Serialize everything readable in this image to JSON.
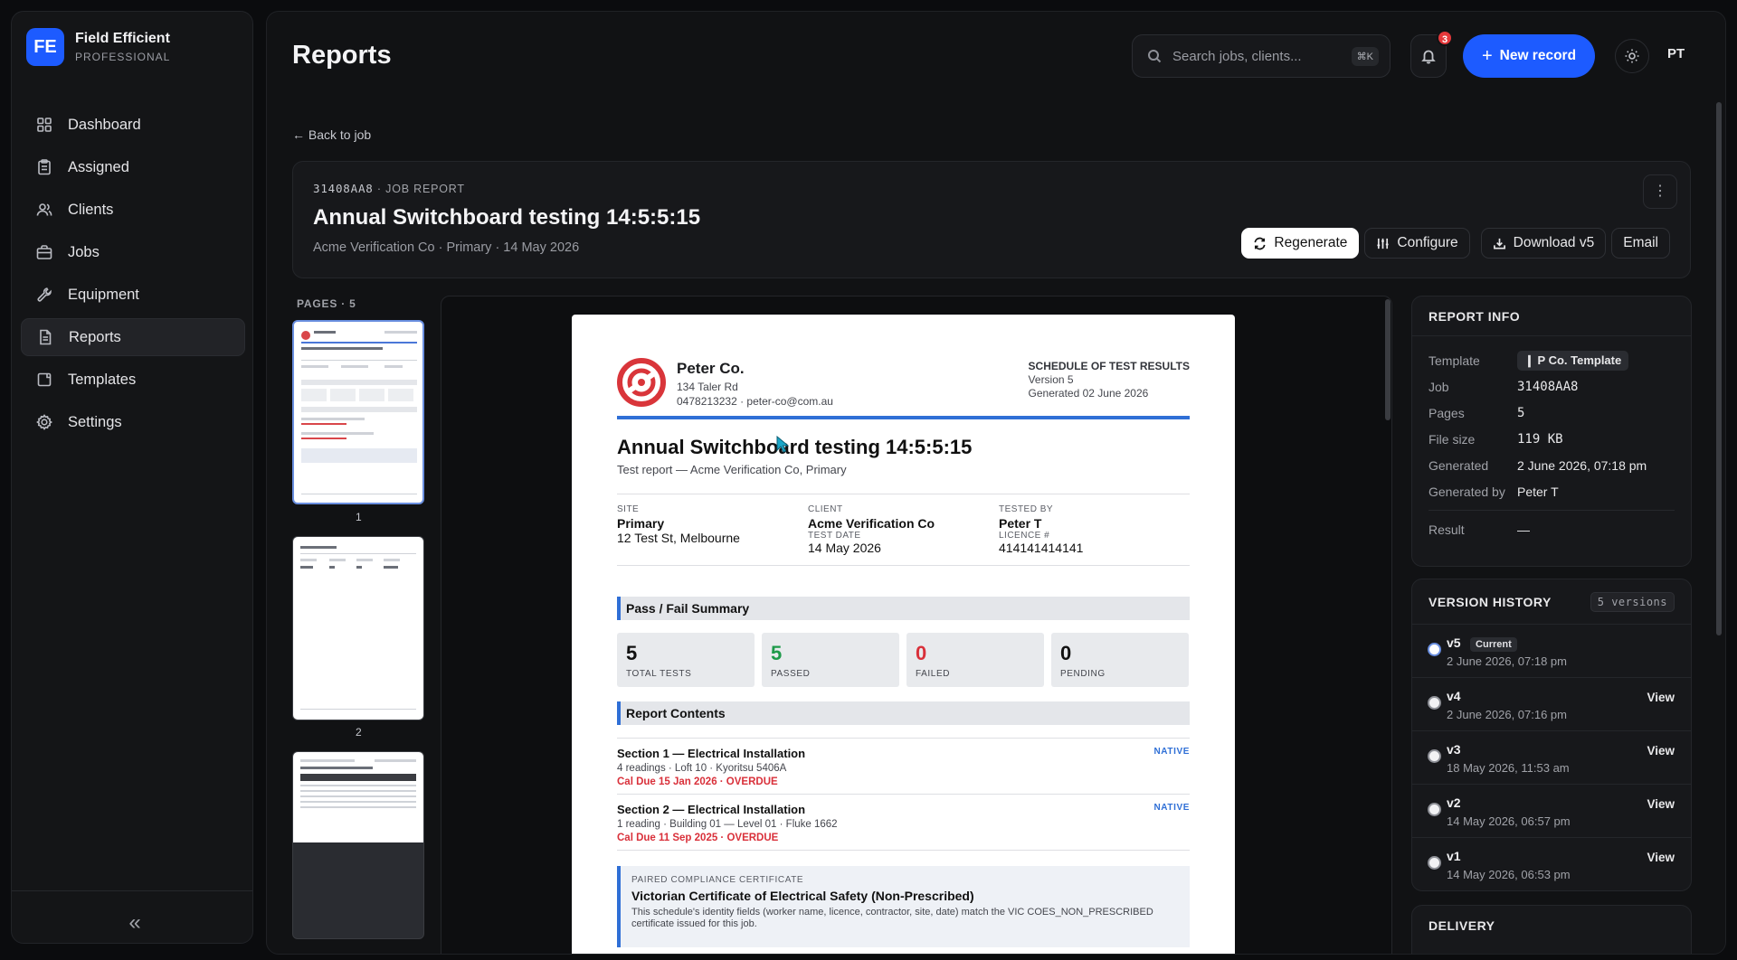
{
  "brand": {
    "logo": "FE",
    "name": "Field Efficient",
    "tier": "PROFESSIONAL"
  },
  "nav": [
    {
      "label": "Dashboard",
      "icon": "grid-icon"
    },
    {
      "label": "Assigned",
      "icon": "clipboard-icon"
    },
    {
      "label": "Clients",
      "icon": "users-icon"
    },
    {
      "label": "Jobs",
      "icon": "briefcase-icon"
    },
    {
      "label": "Equipment",
      "icon": "wrench-icon"
    },
    {
      "label": "Reports",
      "icon": "document-icon",
      "active": true
    },
    {
      "label": "Templates",
      "icon": "template-icon"
    },
    {
      "label": "Settings",
      "icon": "gear-icon"
    }
  ],
  "header": {
    "title": "Reports",
    "search_placeholder": "Search jobs, clients...",
    "search_shortcut": "⌘K",
    "notifications": "3",
    "new_record": "New record",
    "avatar": "PT"
  },
  "back_link": "Back to job",
  "job": {
    "id": "31408AA8",
    "kind": "JOB REPORT",
    "title": "Annual Switchboard testing 14:5:5:15",
    "subtitle": "Acme Verification Co · Primary · 14 May 2026",
    "actions": {
      "regenerate": "Regenerate",
      "configure": "Configure",
      "download": "Download v5",
      "email": "Email"
    }
  },
  "pages": {
    "label": "PAGES · 5",
    "thumbs": [
      "1",
      "2"
    ]
  },
  "report": {
    "company": "Peter Co.",
    "address": "134 Taler Rd",
    "contact": "0478213232 · peter-co@com.au",
    "doc_type": "SCHEDULE OF TEST RESULTS",
    "version": "Version 5",
    "generated": "Generated 02 June 2026",
    "title": "Annual Switchboard testing 14:5:5:15",
    "subtitle": "Test report — Acme Verification Co, Primary",
    "site_label": "SITE",
    "site_name": "Primary",
    "site_addr": "12 Test St, Melbourne",
    "client_label": "CLIENT",
    "client_name": "Acme Verification Co",
    "test_date_label": "TEST DATE",
    "test_date": "14 May 2026",
    "tested_by_label": "TESTED BY",
    "tested_by": "Peter T",
    "licence_label": "LICENCE #",
    "licence": "414141414141",
    "summary_title": "Pass / Fail Summary",
    "stats": [
      {
        "n": "5",
        "l": "TOTAL TESTS"
      },
      {
        "n": "5",
        "l": "PASSED"
      },
      {
        "n": "0",
        "l": "FAILED"
      },
      {
        "n": "0",
        "l": "PENDING"
      }
    ],
    "contents_title": "Report Contents",
    "sections": [
      {
        "title": "Section 1 — Electrical Installation",
        "sub": "4 readings · Loft 10 · Kyoritsu 5406A",
        "due": "Cal Due 15 Jan 2026 · OVERDUE",
        "tag": "NATIVE"
      },
      {
        "title": "Section 2 — Electrical Installation",
        "sub": "1 reading · Building 01 — Level 01 · Fluke 1662",
        "due": "Cal Due 11 Sep 2025 · OVERDUE",
        "tag": "NATIVE"
      }
    ],
    "cert_kicker": "PAIRED COMPLIANCE CERTIFICATE",
    "cert_title": "Victorian Certificate of Electrical Safety (Non-Prescribed)",
    "cert_desc": "This schedule's identity fields (worker name, licence, contractor, site, date) match the VIC COES_NON_PRESCRIBED certificate issued for this job."
  },
  "report_info": {
    "title": "REPORT INFO",
    "template_label": "Template",
    "template": "P Co. Template",
    "job_label": "Job",
    "job": "31408AA8",
    "pages_label": "Pages",
    "pages": "5",
    "size_label": "File size",
    "size": "119 KB",
    "generated_label": "Generated",
    "generated": "2 June 2026, 07:18 pm",
    "by_label": "Generated by",
    "by": "Peter T",
    "result_label": "Result",
    "result": "—"
  },
  "versions": {
    "title": "VERSION HISTORY",
    "count": "5 versions",
    "current_label": "Current",
    "view_label": "View",
    "items": [
      {
        "v": "v5",
        "date": "2 June 2026, 07:18 pm",
        "current": true
      },
      {
        "v": "v4",
        "date": "2 June 2026, 07:16 pm"
      },
      {
        "v": "v3",
        "date": "18 May 2026, 11:53 am"
      },
      {
        "v": "v2",
        "date": "14 May 2026, 06:57 pm"
      },
      {
        "v": "v1",
        "date": "14 May 2026, 06:53 pm"
      }
    ]
  },
  "delivery": {
    "title": "DELIVERY"
  },
  "colors": {
    "accent": "#1d5bff",
    "danger": "#d9303a",
    "success": "#1e9a4a",
    "report_blue": "#2f6fd6"
  }
}
